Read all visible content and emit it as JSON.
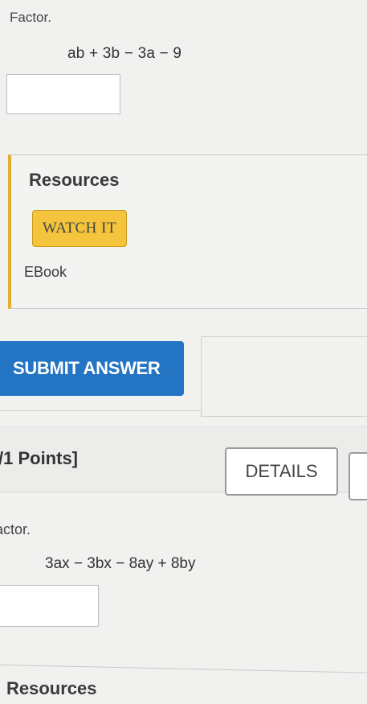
{
  "problem1": {
    "prompt": "Factor.",
    "expression": "ab + 3b − 3a − 9",
    "answer_value": ""
  },
  "resources1": {
    "title": "Resources",
    "watch_label": "WATCH IT",
    "ebook_label": "EBook"
  },
  "submit": {
    "label": "SUBMIT ANSWER"
  },
  "problem2": {
    "points": "/1 Points]",
    "details_label": "DETAILS",
    "prompt": "actor.",
    "expression": "3ax − 3bx − 8ay + 8by",
    "answer_value": ""
  },
  "resources2": {
    "title": "Resources"
  },
  "colors": {
    "accent_blue": "#2374c2",
    "watch_yellow": "#f4c43d",
    "panel_border": "#e2b030"
  }
}
